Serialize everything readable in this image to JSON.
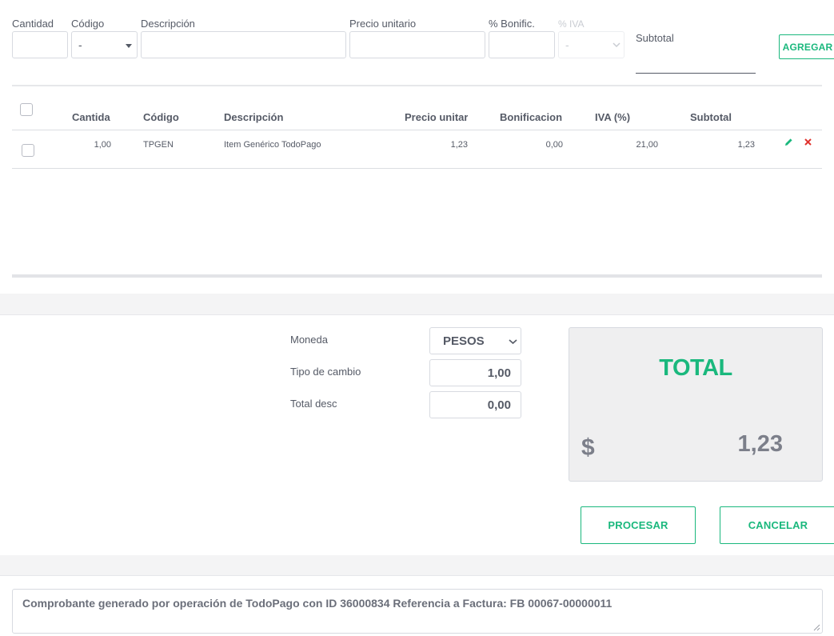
{
  "item_form": {
    "cantidad_label": "Cantidad",
    "codigo_label": "Código",
    "codigo_value": "-",
    "descripcion_label": "Descripción",
    "precio_label": "Precio unitario",
    "bonific_label": "% Bonific.",
    "iva_label": "% IVA",
    "iva_value": "-",
    "subtotal_label": "Subtotal",
    "add_button": "AGREGAR"
  },
  "table": {
    "headers": [
      "Cantidad",
      "Código",
      "Descripción",
      "Precio unitari",
      "Bonificacion (",
      "IVA (%)",
      "Subtotal"
    ],
    "rows": [
      {
        "cantidad": "1,00",
        "codigo": "TPGEN",
        "descripcion": "Item Genérico TodoPago",
        "precio": "1,23",
        "bonificacion": "0,00",
        "iva": "21,00",
        "subtotal": "1,23"
      }
    ]
  },
  "summary": {
    "moneda_label": "Moneda",
    "moneda_value": "PESOS",
    "tipo_cambio_label": "Tipo de cambio",
    "tipo_cambio_value": "1,00",
    "total_desc_label": "Total desc",
    "total_desc_value": "0,00",
    "total_title": "TOTAL",
    "currency_symbol": "$",
    "total_value": "1,23"
  },
  "actions": {
    "procesar": "PROCESAR",
    "cancelar": "CANCELAR"
  },
  "notes": {
    "text": "Comprobante generado por operación de TodoPago con ID 36000834 Referencia a Factura: FB 00067-00000011"
  },
  "colors": {
    "accent": "#1ab87d",
    "delete": "#e0342f",
    "text": "#555a66"
  }
}
